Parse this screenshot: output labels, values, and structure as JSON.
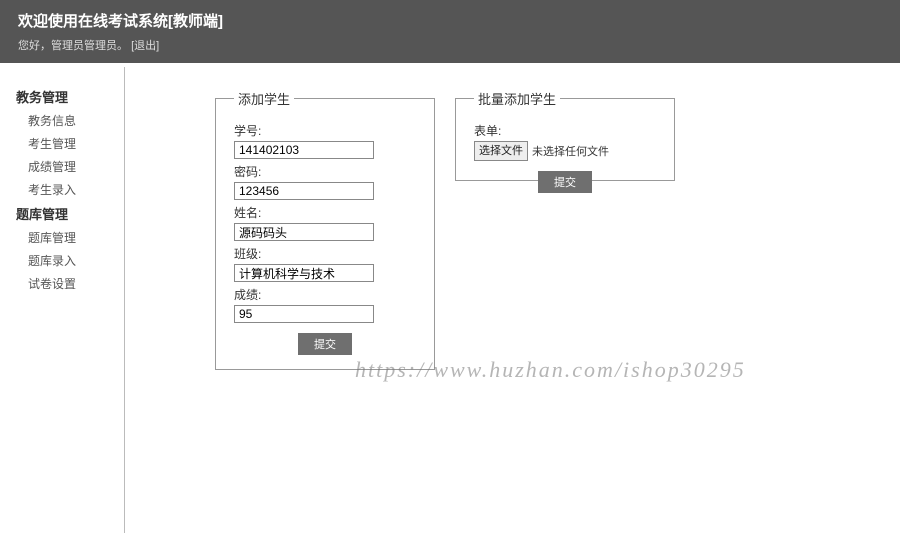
{
  "header": {
    "title": "欢迎使用在线考试系统[教师端]",
    "greeting_prefix": "您好，",
    "user": "管理员管理员",
    "logout_label": "[退出]"
  },
  "sidebar": {
    "groups": [
      {
        "label": "教务管理",
        "items": [
          "教务信息",
          "考生管理",
          "成绩管理",
          "考生录入"
        ]
      },
      {
        "label": "题库管理",
        "items": [
          "题库管理",
          "题库录入",
          "试卷设置"
        ]
      }
    ]
  },
  "add_panel": {
    "legend": "添加学生",
    "fields": {
      "student_id": {
        "label": "学号:",
        "value": "141402103"
      },
      "password": {
        "label": "密码:",
        "value": "123456"
      },
      "name": {
        "label": "姓名:",
        "value": "源码码头"
      },
      "class": {
        "label": "班级:",
        "value": "计算机科学与技术"
      },
      "score": {
        "label": "成绩:",
        "value": "95"
      }
    },
    "submit_label": "提交"
  },
  "bulk_panel": {
    "legend": "批量添加学生",
    "form_label": "表单:",
    "choose_file_label": "选择文件",
    "file_status": "未选择任何文件",
    "submit_label": "提交"
  },
  "watermark": "https://www.huzhan.com/ishop30295"
}
